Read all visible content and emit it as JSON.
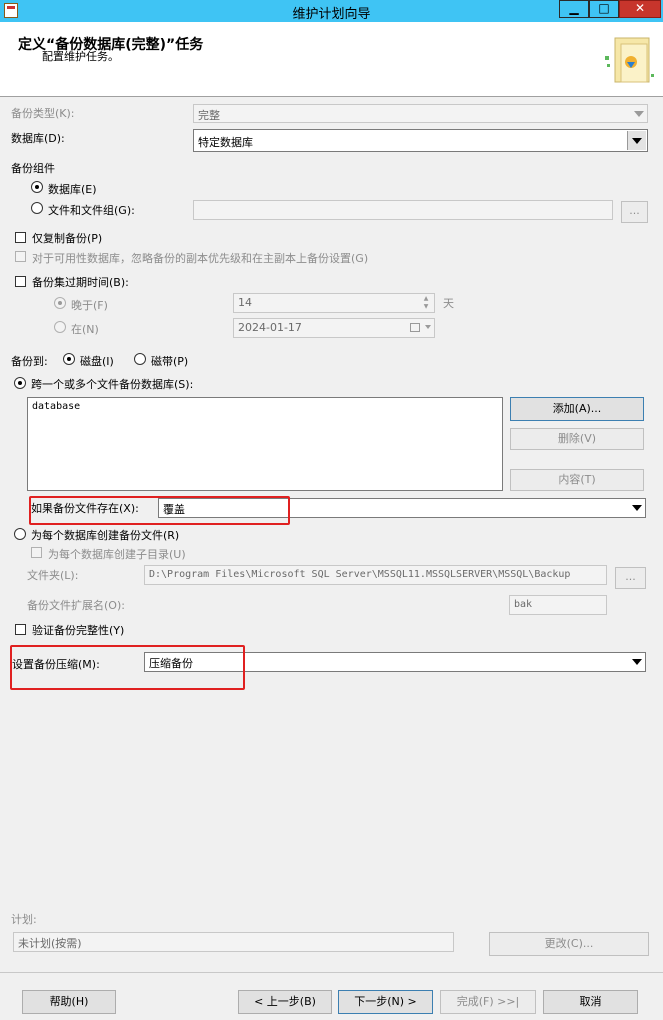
{
  "window": {
    "title": "维护计划向导",
    "minimize": "▁",
    "maximize": "□",
    "close": "✕"
  },
  "header": {
    "title": "定义“备份数据库(完整)”任务",
    "subtitle": "配置维护任务。",
    "icon": "wizard-icon"
  },
  "backup_type": {
    "label": "备份类型(K):",
    "value": "完整"
  },
  "database": {
    "label": "数据库(D):",
    "value": "特定数据库"
  },
  "backup_component": {
    "label": "备份组件",
    "database_option": "数据库(E)",
    "files_option": "文件和文件组(G):",
    "browse": "..."
  },
  "copy_only": {
    "label": "仅复制备份(P)"
  },
  "ag_priority": {
    "label": "对于可用性数据库，忽略备份的副本优先级和在主副本上备份设置(G)"
  },
  "expire": {
    "label": "备份集过期时间(B):",
    "after_label": "晚于(F)",
    "after_value": "14",
    "days_label": "天",
    "on_label": "在(N)",
    "on_value": "2024-01-17"
  },
  "backup_to": {
    "label": "备份到:",
    "disk": "磁盘(I)",
    "tape": "磁带(P)"
  },
  "across_files": {
    "label": "跨一个或多个文件备份数据库(S):",
    "files": [
      "database"
    ],
    "add": "添加(A)...",
    "remove": "删除(V)",
    "contents": "内容(T)"
  },
  "if_exists": {
    "label": "如果备份文件存在(X):",
    "value": "覆盖"
  },
  "per_db": {
    "label": "为每个数据库创建备份文件(R)",
    "subdir": "为每个数据库创建子目录(U)",
    "folder_label": "文件夹(L):",
    "folder_value": "D:\\Program Files\\Microsoft SQL Server\\MSSQL11.MSSQLSERVER\\MSSQL\\Backup",
    "browse": "...",
    "ext_label": "备份文件扩展名(O):",
    "ext_value": "bak"
  },
  "verify": {
    "label": "验证备份完整性(Y)"
  },
  "compression": {
    "label": "设置备份压缩(M):",
    "value": "压缩备份"
  },
  "schedule": {
    "label": "计划:",
    "value": "未计划(按需)",
    "change": "更改(C)..."
  },
  "footer": {
    "help": "帮助(H)",
    "back": "< 上一步(B)",
    "next": "下一步(N) >",
    "finish": "完成(F) >>|",
    "cancel": "取消"
  },
  "colors": {
    "titlebar": "#3fc4f4",
    "close": "#c7352c",
    "highlight": "#e02020"
  }
}
